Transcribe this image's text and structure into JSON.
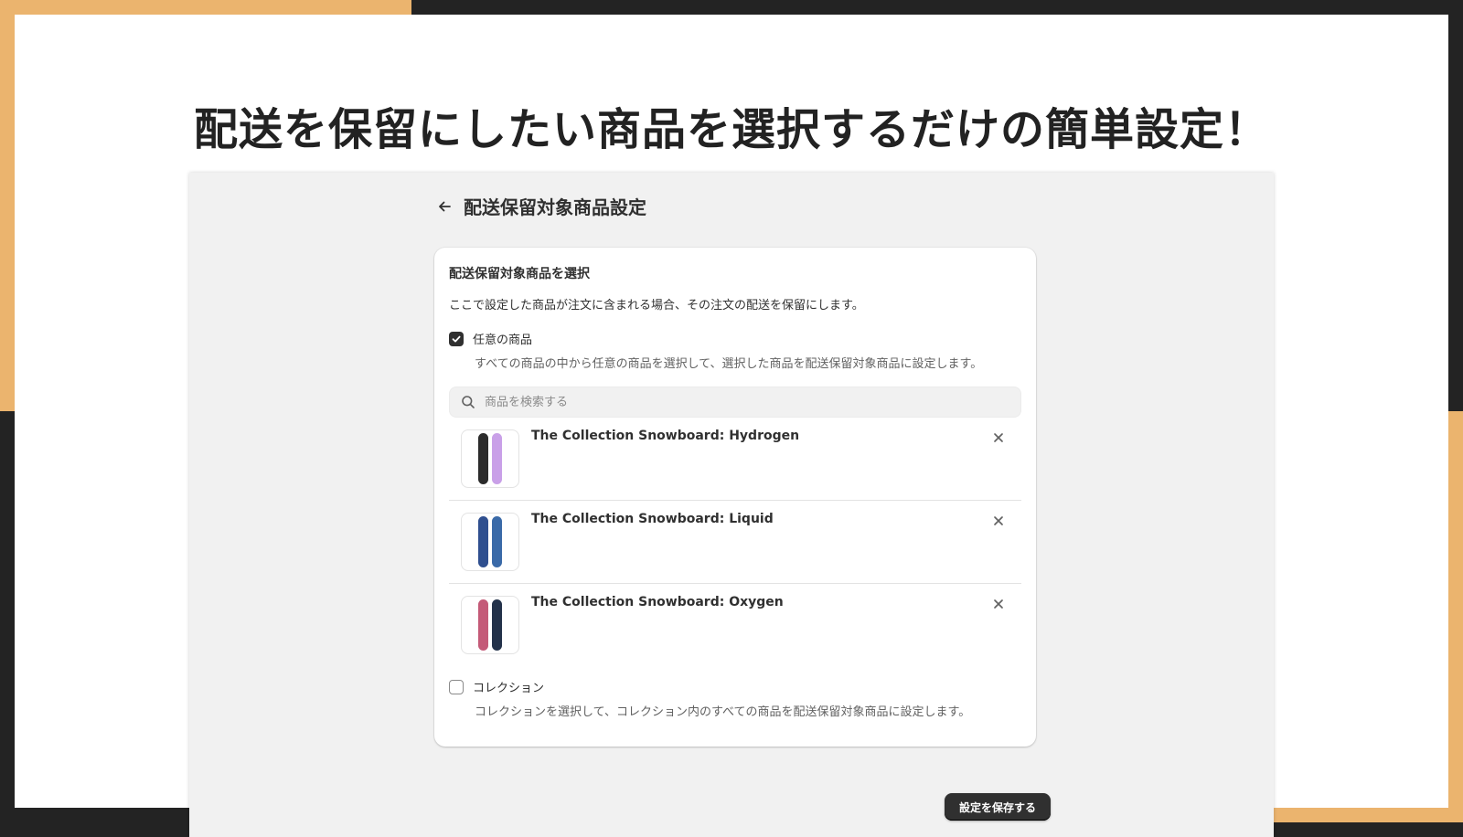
{
  "headline": "配送を保留にしたい商品を選択するだけの簡単設定！",
  "page": {
    "title": "配送保留対象商品設定"
  },
  "card": {
    "title": "配送保留対象商品を選択",
    "description": "ここで設定した商品が注文に含まれる場合、その注文の配送を保留にします。"
  },
  "options": {
    "any_products": {
      "label": "任意の商品",
      "help": "すべての商品の中から任意の商品を選択して、選択した商品を配送保留対象商品に設定します。",
      "checked": true
    },
    "collection": {
      "label": "コレクション",
      "help": "コレクションを選択して、コレクション内のすべての商品を配送保留対象商品に設定します。",
      "checked": false
    }
  },
  "search": {
    "placeholder": "商品を検索する",
    "value": ""
  },
  "products": [
    {
      "name": "The Collection Snowboard: Hydrogen",
      "colors": [
        "#2b2b2b",
        "#c9a0e8"
      ]
    },
    {
      "name": "The Collection Snowboard: Liquid",
      "colors": [
        "#2f4f8f",
        "#3a6aa8"
      ]
    },
    {
      "name": "The Collection Snowboard: Oxygen",
      "colors": [
        "#c45a78",
        "#23324a"
      ]
    }
  ],
  "actions": {
    "save_label": "設定を保存する"
  },
  "colors": {
    "accent_orange": "#ebb46e",
    "frame_dark": "#232323",
    "button_dark": "#303030"
  }
}
